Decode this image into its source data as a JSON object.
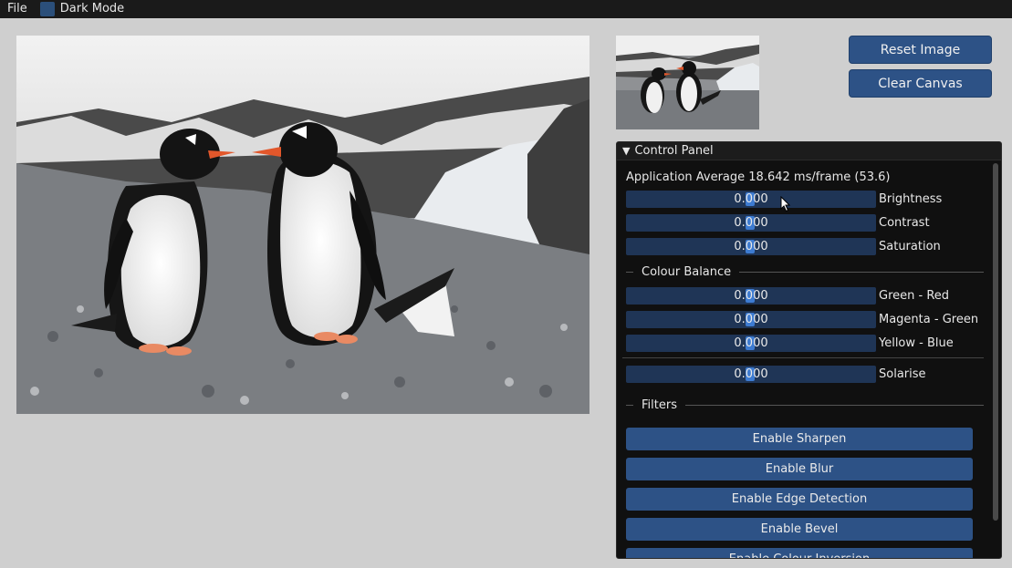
{
  "menu": {
    "file": "File",
    "dark_mode": "Dark Mode"
  },
  "buttons": {
    "reset": "Reset Image",
    "clear": "Clear Canvas"
  },
  "panel": {
    "title": "Control Panel",
    "avg": "Application Average 18.642 ms/frame (53.6)",
    "sliders": [
      {
        "value": "0.000",
        "label": "Brightness"
      },
      {
        "value": "0.000",
        "label": "Contrast"
      },
      {
        "value": "0.000",
        "label": "Saturation"
      }
    ],
    "colour_balance_header": "Colour Balance",
    "balance": [
      {
        "value": "0.000",
        "label": "Green - Red"
      },
      {
        "value": "0.000",
        "label": "Magenta - Green"
      },
      {
        "value": "0.000",
        "label": "Yellow - Blue"
      }
    ],
    "solarise": {
      "value": "0.000",
      "label": "Solarise"
    },
    "filters_header": "Filters",
    "filters": [
      "Enable Sharpen",
      "Enable Blur",
      "Enable Edge Detection",
      "Enable Bevel",
      "Enable Colour Inversion"
    ]
  },
  "colors": {
    "accent": "#2d5286",
    "slider_bg": "#1f3556",
    "grab": "#3d7bd1",
    "panel_bg": "#101010"
  },
  "images": {
    "main": "penguins-photo",
    "thumb": "penguins-thumbnail"
  }
}
